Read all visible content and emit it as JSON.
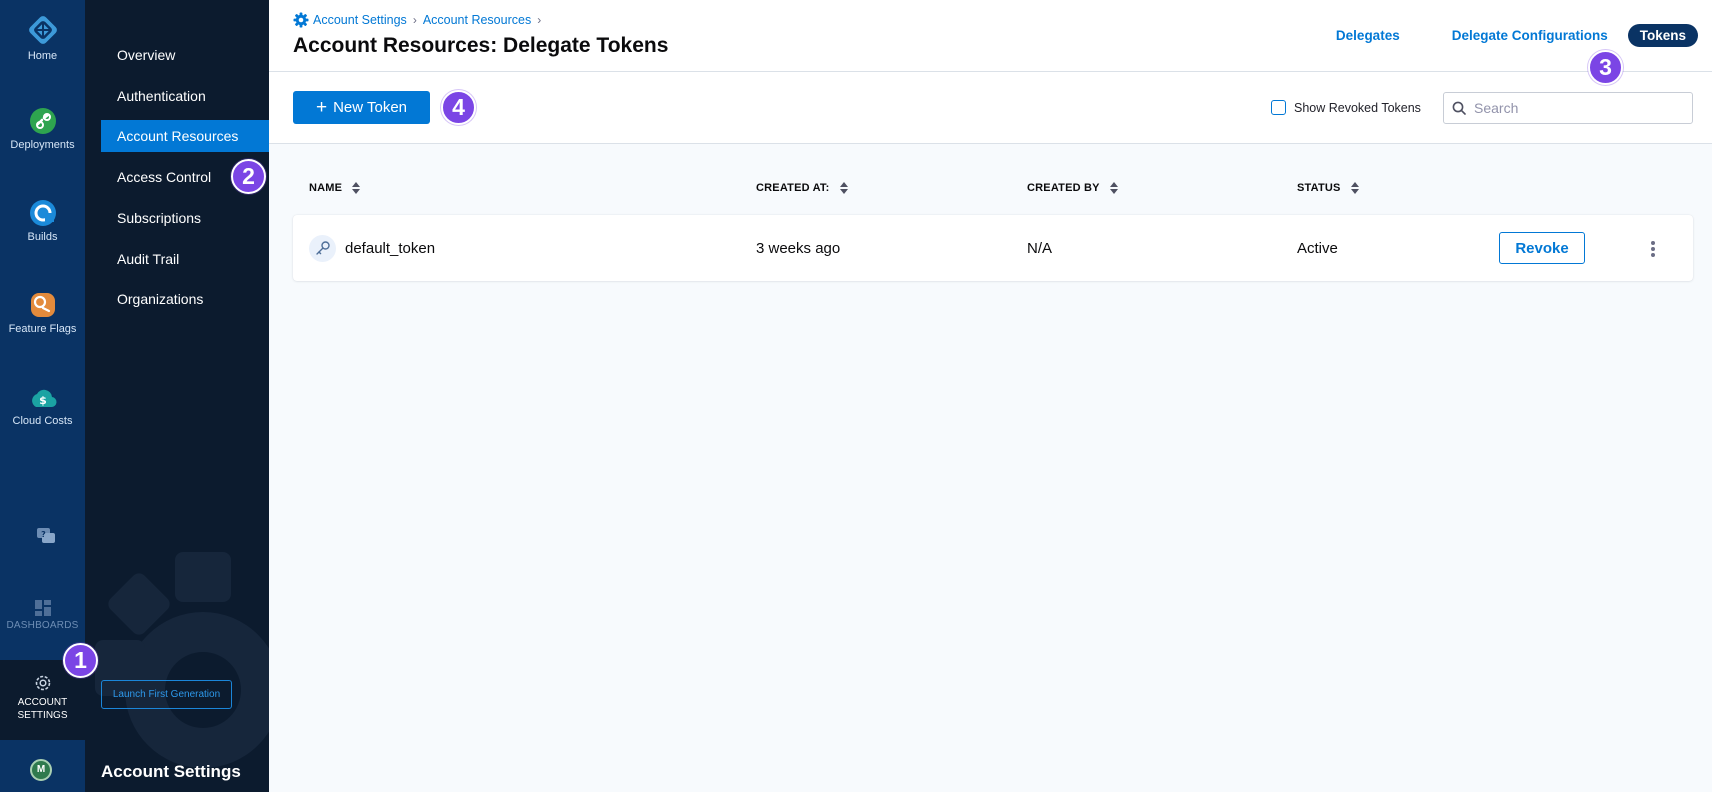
{
  "rail": {
    "items": [
      {
        "label": "Home",
        "icon": "harness-logo-icon"
      },
      {
        "label": "Deployments",
        "icon": "deployments-icon"
      },
      {
        "label": "Builds",
        "icon": "builds-icon"
      },
      {
        "label": "Feature Flags",
        "icon": "feature-flags-icon"
      },
      {
        "label": "Cloud Costs",
        "icon": "cloud-costs-icon"
      }
    ],
    "help_icon": "help-chat-icon",
    "dashboards_label": "DASHBOARDS",
    "account_label_1": "ACCOUNT",
    "account_label_2": "SETTINGS",
    "avatar_initial": "M"
  },
  "sidebar": {
    "items": [
      {
        "label": "Overview"
      },
      {
        "label": "Authentication"
      },
      {
        "label": "Account Resources",
        "active": true
      },
      {
        "label": "Access Control"
      },
      {
        "label": "Subscriptions"
      },
      {
        "label": "Audit Trail"
      },
      {
        "label": "Organizations"
      }
    ],
    "launch_button": "Launch First Generation",
    "title": "Account Settings"
  },
  "header": {
    "breadcrumb": [
      "Account Settings",
      "Account Resources"
    ],
    "title": "Account Resources: Delegate Tokens",
    "tabs": [
      {
        "label": "Delegates"
      },
      {
        "label": "Delegate Configurations"
      },
      {
        "label": "Tokens",
        "active": true
      }
    ]
  },
  "toolbar": {
    "new_token_label": "New Token",
    "show_revoked_label": "Show Revoked Tokens",
    "show_revoked_checked": false,
    "search_placeholder": "Search"
  },
  "table": {
    "columns": [
      "NAME",
      "CREATED AT:",
      "CREATED BY",
      "STATUS"
    ],
    "rows": [
      {
        "name": "default_token",
        "created_at": "3 weeks ago",
        "created_by": "N/A",
        "status": "Active",
        "action": "Revoke"
      }
    ]
  },
  "markers": [
    "1",
    "2",
    "3",
    "4"
  ],
  "colors": {
    "rail_bg": "#0a3364",
    "sidebar_bg": "#0c1b2e",
    "accent": "#0278d5",
    "marker": "#7b45e5"
  }
}
